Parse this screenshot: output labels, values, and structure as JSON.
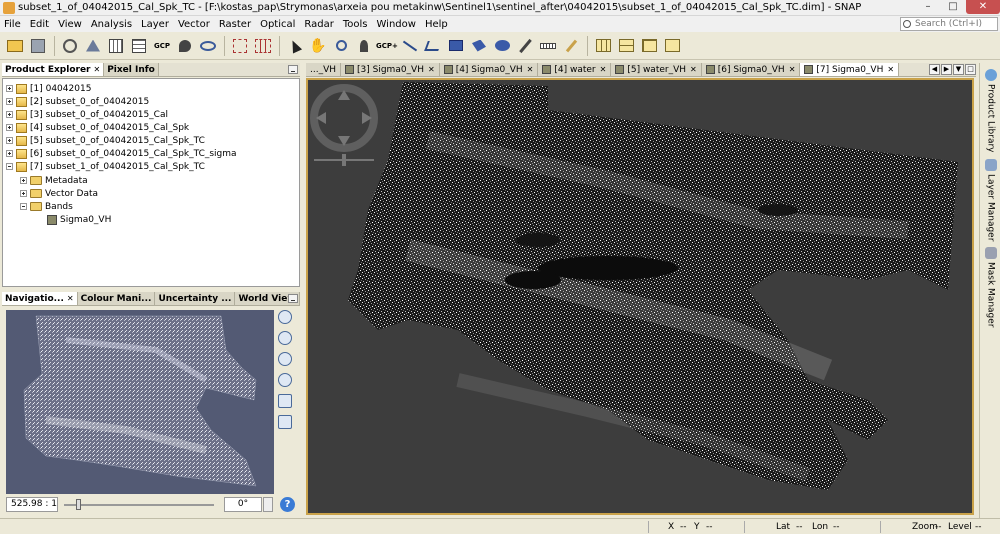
{
  "window": {
    "title": "subset_1_of_04042015_Cal_Spk_TC - [F:\\kostas_pap\\Strymonas\\arxeia pou metakinw\\Sentinel1\\sentinel_after\\04042015\\subset_1_of_04042015_Cal_Spk_TC.dim] - SNAP"
  },
  "menu": [
    "File",
    "Edit",
    "View",
    "Analysis",
    "Layer",
    "Vector",
    "Raster",
    "Optical",
    "Radar",
    "Tools",
    "Window",
    "Help"
  ],
  "search": {
    "placeholder": "Search (Ctrl+I)"
  },
  "left_panel": {
    "tabs": [
      "Product Explorer",
      "Pixel Info"
    ],
    "products": [
      "[1] 04042015",
      "[2] subset_0_of_04042015",
      "[3] subset_0_of_04042015_Cal",
      "[4] subset_0_of_04042015_Cal_Spk",
      "[5] subset_0_of_04042015_Cal_Spk_TC",
      "[6] subset_0_of_04042015_Cal_Spk_TC_sigma",
      "[7] subset_1_of_04042015_Cal_Spk_TC"
    ],
    "children": [
      "Metadata",
      "Vector Data",
      "Bands"
    ],
    "band": "Sigma0_VH"
  },
  "nav_panel": {
    "tabs": [
      "Navigatio...",
      "Colour Mani...",
      "Uncertainty ...",
      "World View"
    ],
    "scale": "525.98 : 1",
    "rotation": "0°",
    "help": "?"
  },
  "doc_tabs": [
    "..._VH",
    "[3] Sigma0_VH",
    "[4] Sigma0_VH",
    "[4] water",
    "[5] water_VH",
    "[6] Sigma0_VH",
    "[7] Sigma0_VH"
  ],
  "right_sidebar": [
    "Product Library",
    "Layer Manager",
    "Mask Manager"
  ],
  "status": {
    "x": "X",
    "x_val": "--",
    "y": "Y",
    "y_val": "--",
    "lat": "Lat",
    "lat_val": "--",
    "lon": "Lon",
    "lon_val": "--",
    "zoom": "Zoom",
    "zoom_val": "--",
    "level": "Level",
    "level_val": "--"
  },
  "colors": {
    "accent_border": "#c9a24a",
    "view_bg": "#3d3d3d",
    "nav_bg": "#535a74"
  }
}
